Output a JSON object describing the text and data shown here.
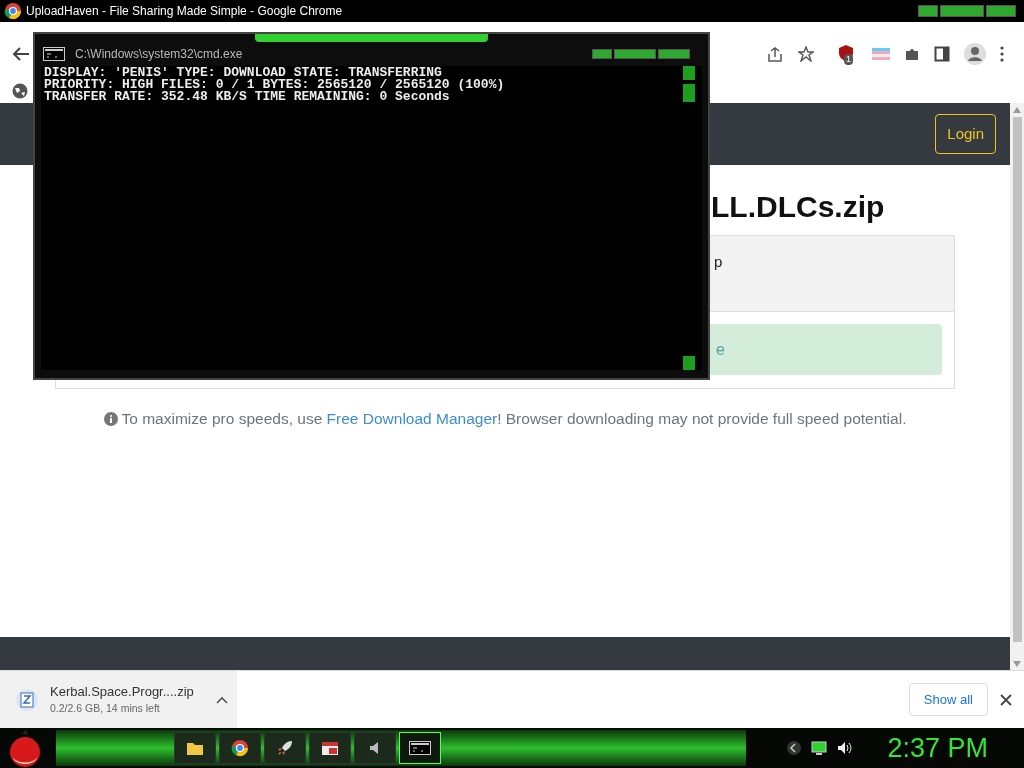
{
  "window": {
    "title": "UploadHaven - File Sharing Made Simple - Google Chrome"
  },
  "browser_toolbar": {
    "extension_badge": "1"
  },
  "site": {
    "login": "Login",
    "heading": "LL.DLCs.zip",
    "card_text": "p",
    "alert_text": "e",
    "info": {
      "before": "To maximize pro speeds, use ",
      "link": "Free Download Manager",
      "after": "! Browser downloading may not provide full speed potential."
    }
  },
  "cmd": {
    "title": "C:\\Windows\\system32\\cmd.exe",
    "lines": [
      "DISPLAY: 'PENIS' TYPE: DOWNLOAD STATE: TRANSFERRING",
      "PRIORITY: HIGH FILES: 0 / 1 BYTES: 2565120 / 2565120 (100%)",
      "TRANSFER RATE: 352.48 KB/S TIME REMAINING: 0 Seconds"
    ]
  },
  "download": {
    "filename": "Kerbal.Space.Progr....zip",
    "status": "0.2/2.6 GB, 14 mins left",
    "show_all": "Show all"
  },
  "taskbar": {
    "apps": [
      {
        "kind": "folder",
        "selected": false
      },
      {
        "kind": "browser",
        "selected": false
      },
      {
        "kind": "rocket",
        "selected": false
      },
      {
        "kind": "media",
        "selected": false
      },
      {
        "kind": "speaker",
        "selected": false
      },
      {
        "kind": "terminal",
        "selected": true
      }
    ],
    "clock": "2:37 PM"
  }
}
